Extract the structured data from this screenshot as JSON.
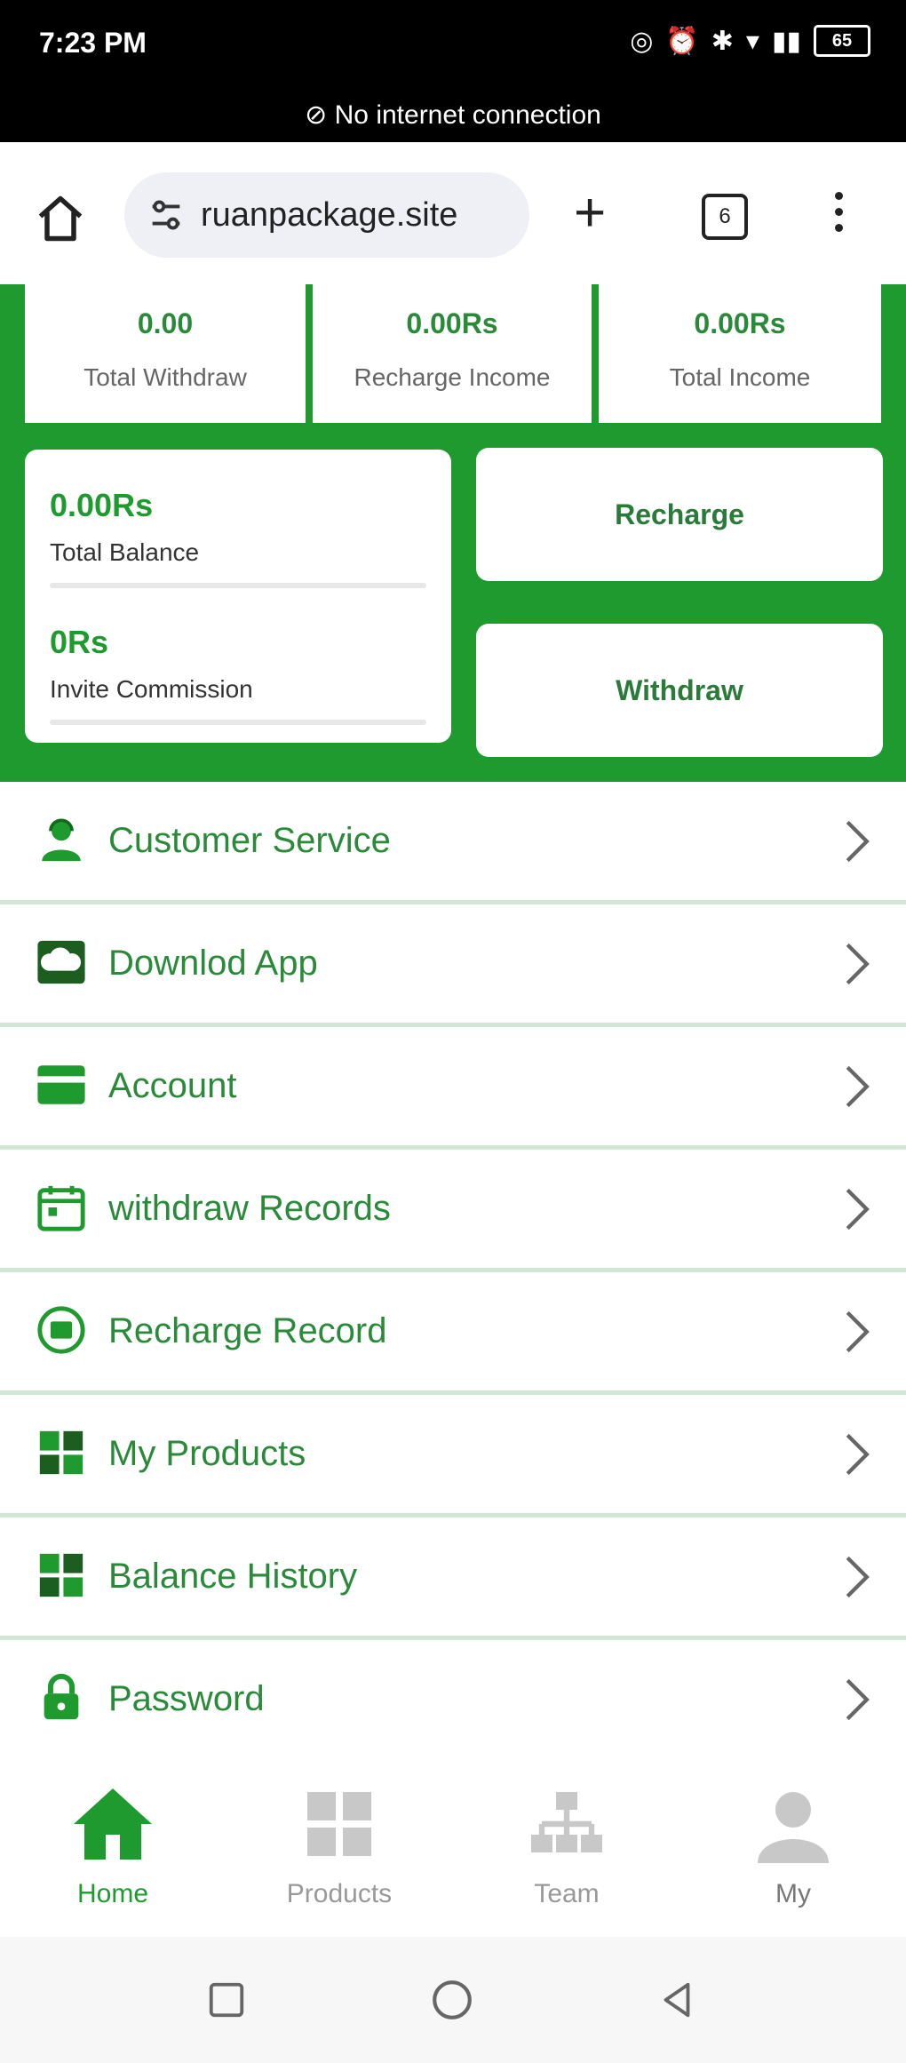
{
  "status_bar": {
    "time": "7:23 PM",
    "icons": [
      "hotspot-icon",
      "alarm-icon",
      "bluetooth-icon",
      "wifi-icon",
      "signal-icon",
      "battery-icon"
    ],
    "battery": "65",
    "notice": "No internet connection"
  },
  "browser": {
    "url": "ruanpackage.site",
    "tab_count": "6"
  },
  "stats": [
    {
      "value": "0.00",
      "label": "Total Withdraw"
    },
    {
      "value": "0.00Rs",
      "label": "Recharge Income"
    },
    {
      "value": "0.00Rs",
      "label": "Total Income"
    }
  ],
  "balance": {
    "total_balance_value": "0.00Rs",
    "total_balance_label": "Total Balance",
    "invite_commission_value": "0Rs",
    "invite_commission_label": "Invite Commission"
  },
  "actions": {
    "recharge_label": "Recharge",
    "withdraw_label": "Withdraw"
  },
  "menu": [
    {
      "label": "Customer Service",
      "icon": "support-agent-icon"
    },
    {
      "label": "Downlod App",
      "icon": "cloud-download-icon"
    },
    {
      "label": "Account",
      "icon": "card-icon"
    },
    {
      "label": "withdraw Records",
      "icon": "calendar-icon"
    },
    {
      "label": "Recharge Record",
      "icon": "recharge-icon"
    },
    {
      "label": "My Products",
      "icon": "grid-icon"
    },
    {
      "label": "Balance History",
      "icon": "grid-icon"
    },
    {
      "label": "Password",
      "icon": "lock-icon"
    }
  ],
  "tabs": [
    {
      "label": "Home",
      "active": true
    },
    {
      "label": "Products",
      "active": false
    },
    {
      "label": "Team",
      "active": false
    },
    {
      "label": "My",
      "active": false
    }
  ],
  "colors": {
    "brand_green": "#1f9a2e",
    "text_green": "#2a8a3a",
    "inactive_gray": "#c8c8c8"
  }
}
